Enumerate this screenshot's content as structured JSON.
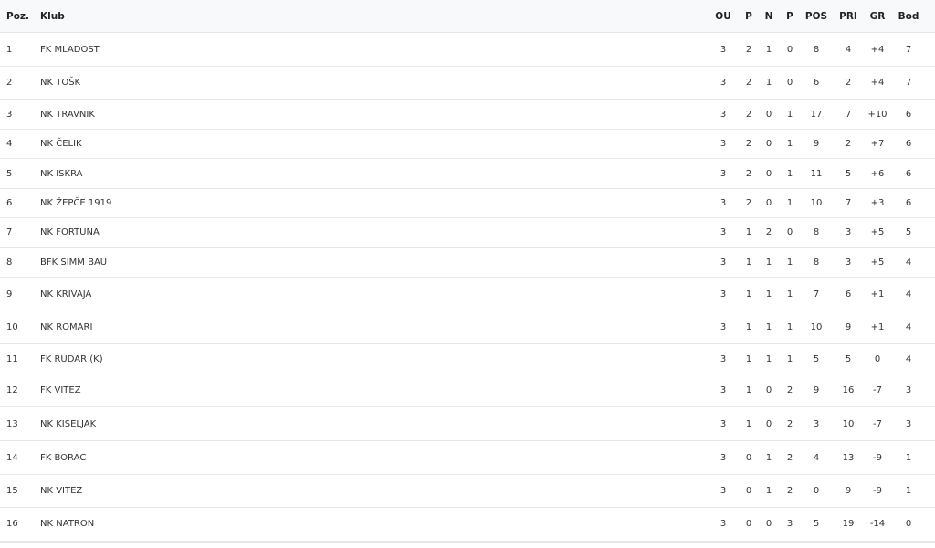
{
  "header": {
    "poz": "Poz.",
    "klub": "Klub",
    "ou": "OU",
    "p1": "P",
    "n": "N",
    "p2": "P",
    "pos": "POS",
    "pri": "PRI",
    "gr": "GR",
    "bod": "Bod"
  },
  "rows": [
    {
      "poz": "1",
      "klub": "FK MLADOST",
      "ou": "3",
      "w": "2",
      "n": "1",
      "l": "0",
      "pos": "8",
      "pri": "4",
      "gr": "+4",
      "bod": "7"
    },
    {
      "poz": "2",
      "klub": "NK TOŠK",
      "ou": "3",
      "w": "2",
      "n": "1",
      "l": "0",
      "pos": "6",
      "pri": "2",
      "gr": "+4",
      "bod": "7"
    },
    {
      "poz": "3",
      "klub": "NK TRAVNIK",
      "ou": "3",
      "w": "2",
      "n": "0",
      "l": "1",
      "pos": "17",
      "pri": "7",
      "gr": "+10",
      "bod": "6"
    },
    {
      "poz": "4",
      "klub": "NK ČELIK",
      "ou": "3",
      "w": "2",
      "n": "0",
      "l": "1",
      "pos": "9",
      "pri": "2",
      "gr": "+7",
      "bod": "6"
    },
    {
      "poz": "5",
      "klub": "NK ISKRA",
      "ou": "3",
      "w": "2",
      "n": "0",
      "l": "1",
      "pos": "11",
      "pri": "5",
      "gr": "+6",
      "bod": "6"
    },
    {
      "poz": "6",
      "klub": "NK ŽEPČE 1919",
      "ou": "3",
      "w": "2",
      "n": "0",
      "l": "1",
      "pos": "10",
      "pri": "7",
      "gr": "+3",
      "bod": "6"
    },
    {
      "poz": "7",
      "klub": "NK FORTUNA",
      "ou": "3",
      "w": "1",
      "n": "2",
      "l": "0",
      "pos": "8",
      "pri": "3",
      "gr": "+5",
      "bod": "5"
    },
    {
      "poz": "8",
      "klub": "BFK SIMM BAU",
      "ou": "3",
      "w": "1",
      "n": "1",
      "l": "1",
      "pos": "8",
      "pri": "3",
      "gr": "+5",
      "bod": "4"
    },
    {
      "poz": "9",
      "klub": "NK KRIVAJA",
      "ou": "3",
      "w": "1",
      "n": "1",
      "l": "1",
      "pos": "7",
      "pri": "6",
      "gr": "+1",
      "bod": "4"
    },
    {
      "poz": "10",
      "klub": "NK ROMARI",
      "ou": "3",
      "w": "1",
      "n": "1",
      "l": "1",
      "pos": "10",
      "pri": "9",
      "gr": "+1",
      "bod": "4"
    },
    {
      "poz": "11",
      "klub": "FK RUDAR (K)",
      "ou": "3",
      "w": "1",
      "n": "1",
      "l": "1",
      "pos": "5",
      "pri": "5",
      "gr": "0",
      "bod": "4"
    },
    {
      "poz": "12",
      "klub": "FK VITEZ",
      "ou": "3",
      "w": "1",
      "n": "0",
      "l": "2",
      "pos": "9",
      "pri": "16",
      "gr": "-7",
      "bod": "3"
    },
    {
      "poz": "13",
      "klub": "NK KISELJAK",
      "ou": "3",
      "w": "1",
      "n": "0",
      "l": "2",
      "pos": "3",
      "pri": "10",
      "gr": "-7",
      "bod": "3"
    },
    {
      "poz": "14",
      "klub": "FK BORAC",
      "ou": "3",
      "w": "0",
      "n": "1",
      "l": "2",
      "pos": "4",
      "pri": "13",
      "gr": "-9",
      "bod": "1"
    },
    {
      "poz": "15",
      "klub": "NK VITEZ",
      "ou": "3",
      "w": "0",
      "n": "1",
      "l": "2",
      "pos": "0",
      "pri": "9",
      "gr": "-9",
      "bod": "1"
    },
    {
      "poz": "16",
      "klub": "NK NATRON",
      "ou": "3",
      "w": "0",
      "n": "0",
      "l": "3",
      "pos": "5",
      "pri": "19",
      "gr": "-14",
      "bod": "0"
    }
  ]
}
